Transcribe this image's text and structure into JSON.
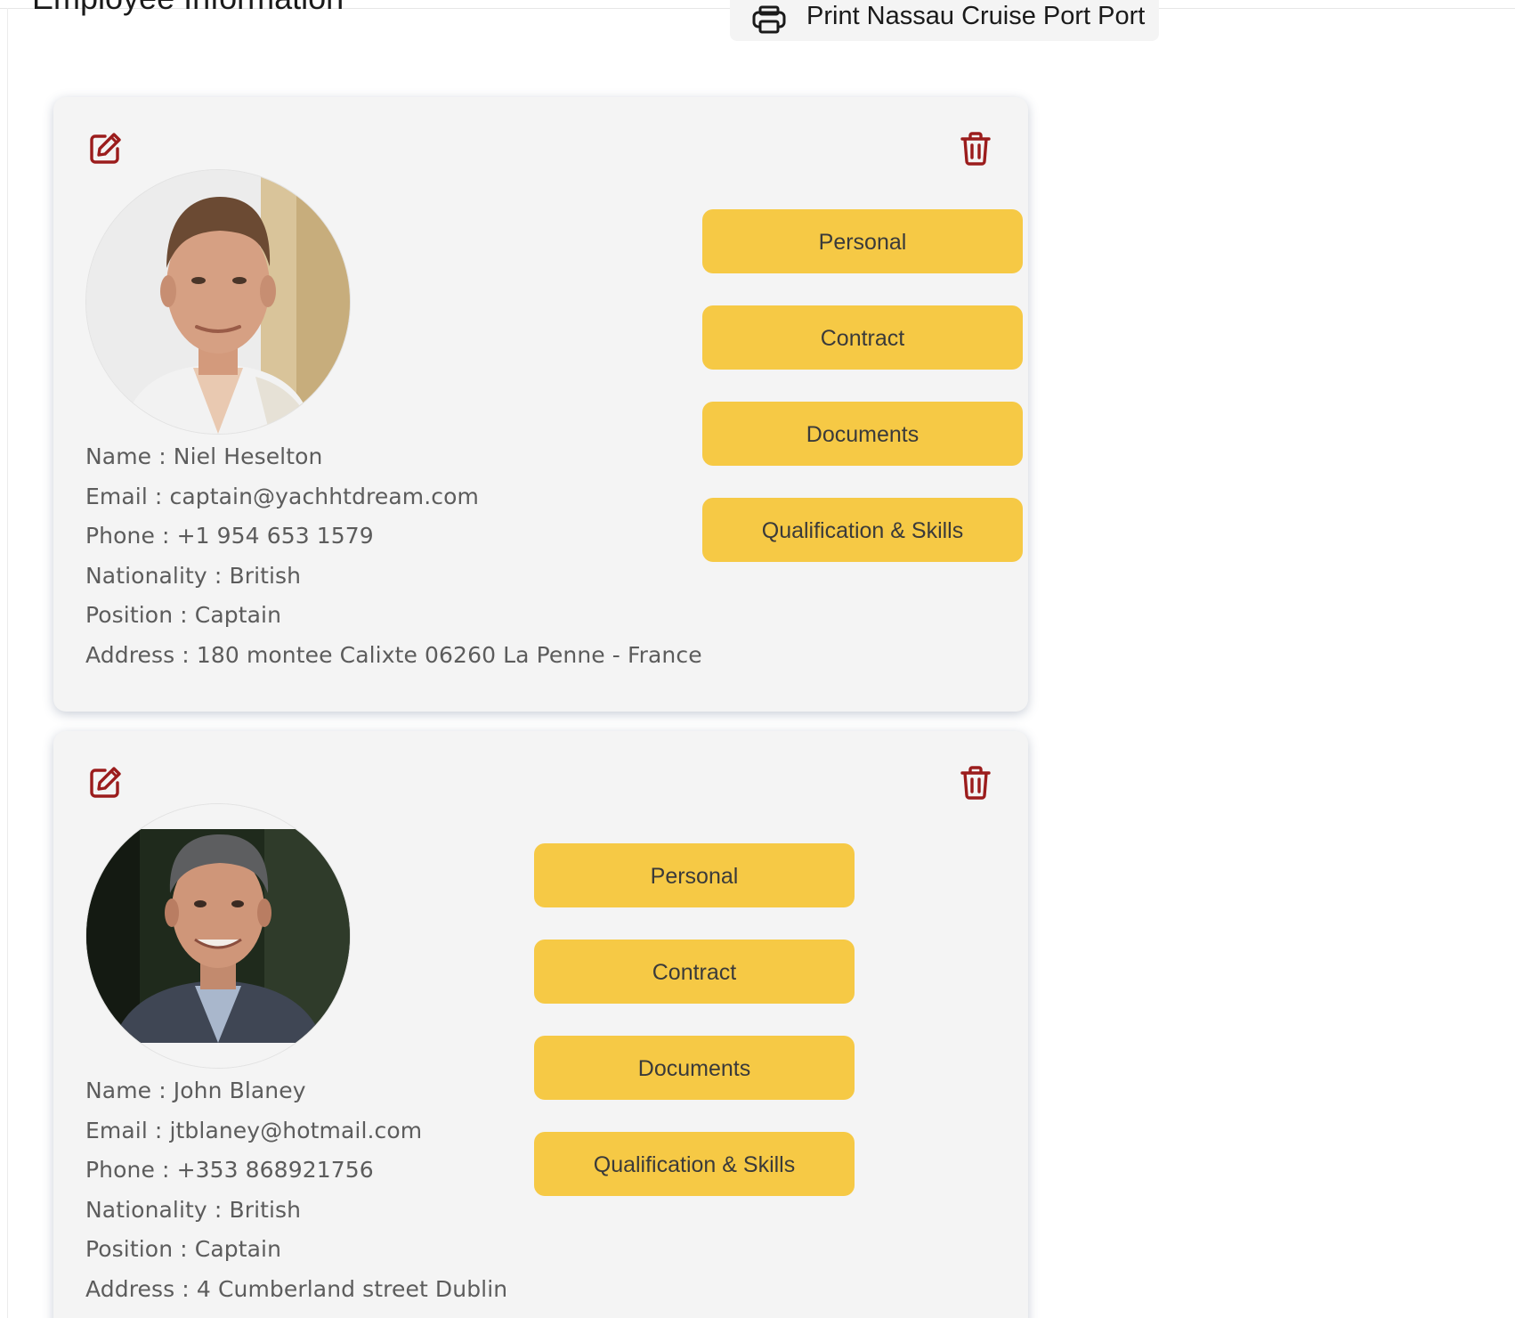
{
  "header": {
    "title": "Employee Information",
    "print_button_label": "Print Nassau Cruise Port Port",
    "print_icon": "printer-icon"
  },
  "colors": {
    "card_background": "#f4f4f4",
    "action_button": "#f6c945",
    "icon_red": "#9b1c1c",
    "info_text": "#5c5c5c"
  },
  "employees": [
    {
      "edit_icon": "edit-icon",
      "delete_icon": "trash-icon",
      "photo_alt": "avatar",
      "fields": [
        {
          "label": "Name : ",
          "value": "Niel Heselton"
        },
        {
          "label": "Email : ",
          "value": "captain@yachhtdream.com"
        },
        {
          "label": "Phone : ",
          "value": "+1 954 653 1579"
        },
        {
          "label": "Nationality : ",
          "value": "British"
        },
        {
          "label": "Position : ",
          "value": "Captain"
        },
        {
          "label": "Address : ",
          "value": "180 montee Calixte 06260 La Penne - France"
        }
      ],
      "actions": [
        "Personal",
        "Contract",
        "Documents",
        "Qualification & Skills"
      ]
    },
    {
      "edit_icon": "edit-icon",
      "delete_icon": "trash-icon",
      "photo_alt": "avatar",
      "fields": [
        {
          "label": "Name : ",
          "value": "John Blaney"
        },
        {
          "label": "Email : ",
          "value": "jtblaney@hotmail.com"
        },
        {
          "label": "Phone : ",
          "value": "+353 868921756"
        },
        {
          "label": "Nationality : ",
          "value": "British"
        },
        {
          "label": "Position : ",
          "value": "Captain"
        },
        {
          "label": "Address : ",
          "value": "4 Cumberland street Dublin"
        }
      ],
      "actions": [
        "Personal",
        "Contract",
        "Documents",
        "Qualification & Skills"
      ]
    }
  ]
}
